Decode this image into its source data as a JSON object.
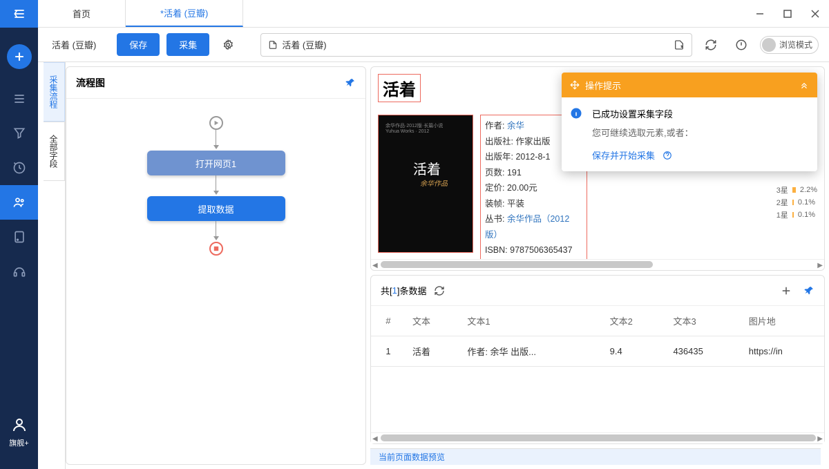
{
  "tabs": {
    "home": "首页",
    "active": "*活着 (豆瓣)"
  },
  "toolbar": {
    "task_name": "活着 (豆瓣)",
    "save": "保存",
    "run": "采集",
    "url": "活着 (豆瓣)",
    "mode": "浏览模式"
  },
  "side_tabs": {
    "flow": "采集流程",
    "fields": "全部字段"
  },
  "flow": {
    "title": "流程图",
    "node_open": "打开网页1",
    "node_extract": "提取数据"
  },
  "preview": {
    "title": "活着",
    "cover_text": "活着",
    "meta": {
      "author_label": "作者:",
      "author": "余华",
      "publisher_label": "出版社:",
      "publisher": "作家出版",
      "year_label": "出版年:",
      "year": "2012-8-1",
      "pages_label": "页数:",
      "pages": "191",
      "price_label": "定价:",
      "price": "20.00元",
      "binding_label": "装帧:",
      "binding": "平装",
      "series_label": "丛书:",
      "series": "余华作品（2012版）",
      "isbn_label": "ISBN:",
      "isbn": "9787506365437"
    },
    "stars": [
      {
        "label": "3星",
        "val": "2.2%"
      },
      {
        "label": "2星",
        "val": "0.1%"
      },
      {
        "label": "1星",
        "val": "0.1%"
      }
    ]
  },
  "popup": {
    "header": "操作提示",
    "title": "已成功设置采集字段",
    "sub": "您可继续选取元素,或者：",
    "action": "保存并开始采集"
  },
  "grid": {
    "total_prefix": "共[",
    "count": "1",
    "total_suffix": "]条数据",
    "headers": {
      "idx": "#",
      "c1": "文本",
      "c2": "文本1",
      "c3": "文本2",
      "c4": "文本3",
      "c5": "图片地"
    },
    "row": {
      "idx": "1",
      "c1": "活着",
      "c2": "作者: 余华 出版...",
      "c3": "9.4",
      "c4": "436435",
      "c5": "https://in"
    }
  },
  "footer": "当前页面数据预览",
  "plan": "旗舰+"
}
